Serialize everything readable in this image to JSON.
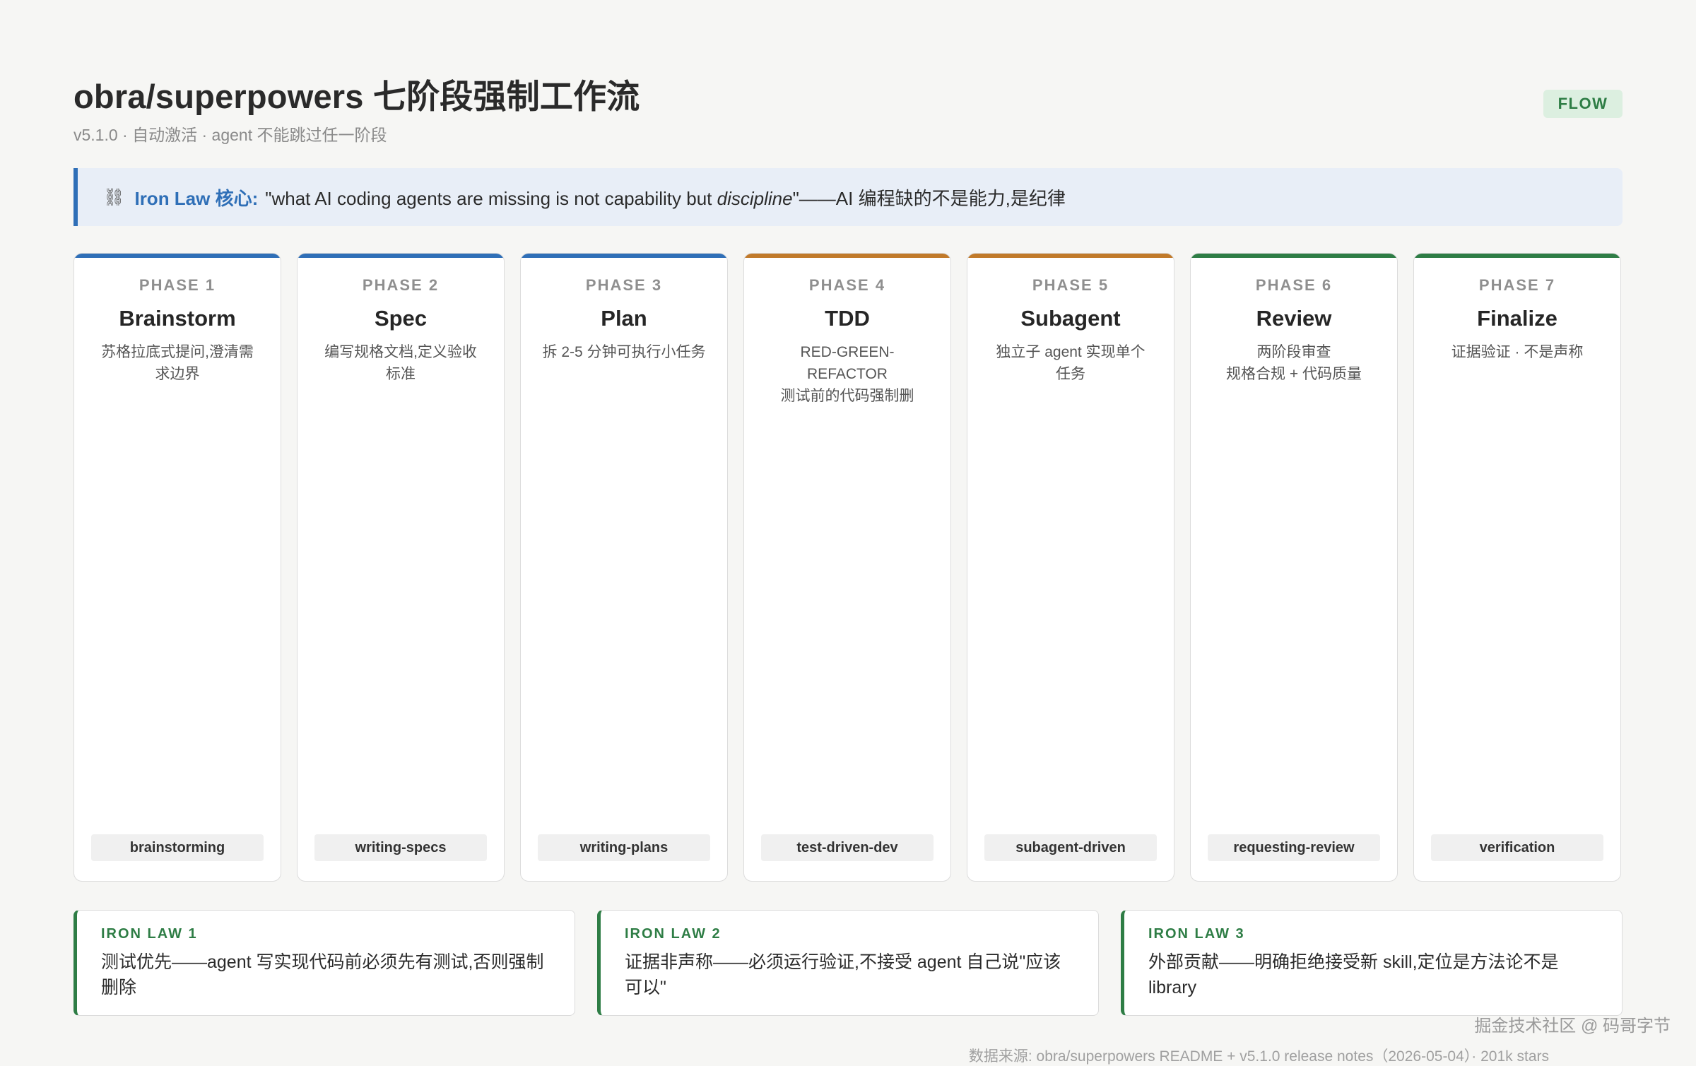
{
  "header": {
    "title": "obra/superpowers 七阶段强制工作流",
    "subtitle": "v5.1.0 · 自动激活 · agent 不能跳过任一阶段",
    "badge": "FLOW"
  },
  "banner": {
    "icon": "chain-icon",
    "icon_glyph": "⛓",
    "label": "Iron Law 核心:",
    "quote_pre": "\"what AI coding agents are missing is not capability but ",
    "quote_em": "discipline",
    "quote_post": "\"——AI 编程缺的不是能力,是纪律"
  },
  "phases": [
    {
      "num": "PHASE 1",
      "name": "Brainstorm",
      "desc": "苏格拉底式提问,澄清需求边界",
      "skill": "brainstorming",
      "color": "#2f6fb7"
    },
    {
      "num": "PHASE 2",
      "name": "Spec",
      "desc": "编写规格文档,定义验收标准",
      "skill": "writing-specs",
      "color": "#2f6fb7"
    },
    {
      "num": "PHASE 3",
      "name": "Plan",
      "desc": "拆 2-5 分钟可执行小任务",
      "skill": "writing-plans",
      "color": "#2f6fb7"
    },
    {
      "num": "PHASE 4",
      "name": "TDD",
      "desc": "RED-GREEN-REFACTOR\n测试前的代码强制删",
      "skill": "test-driven-dev",
      "color": "#c17a2a"
    },
    {
      "num": "PHASE 5",
      "name": "Subagent",
      "desc": "独立子 agent 实现单个任务",
      "skill": "subagent-driven",
      "color": "#c17a2a"
    },
    {
      "num": "PHASE 6",
      "name": "Review",
      "desc": "两阶段审查\n规格合规 + 代码质量",
      "skill": "requesting-review",
      "color": "#2e7d45"
    },
    {
      "num": "PHASE 7",
      "name": "Finalize",
      "desc": "证据验证 · 不是声称",
      "skill": "verification",
      "color": "#2e7d45"
    }
  ],
  "laws": [
    {
      "title": "IRON LAW 1",
      "body": "测试优先——agent 写实现代码前必须先有测试,否则强制删除"
    },
    {
      "title": "IRON LAW 2",
      "body": "证据非声称——必须运行验证,不接受 agent 自己说\"应该可以\""
    },
    {
      "title": "IRON LAW 3",
      "body": "外部贡献——明确拒绝接受新 skill,定位是方法论不是 library"
    }
  ],
  "watermark": "掘金技术社区 @ 码哥字节",
  "source": "数据来源: obra/superpowers README + v5.1.0 release notes（2026-05-04）· 201k stars"
}
